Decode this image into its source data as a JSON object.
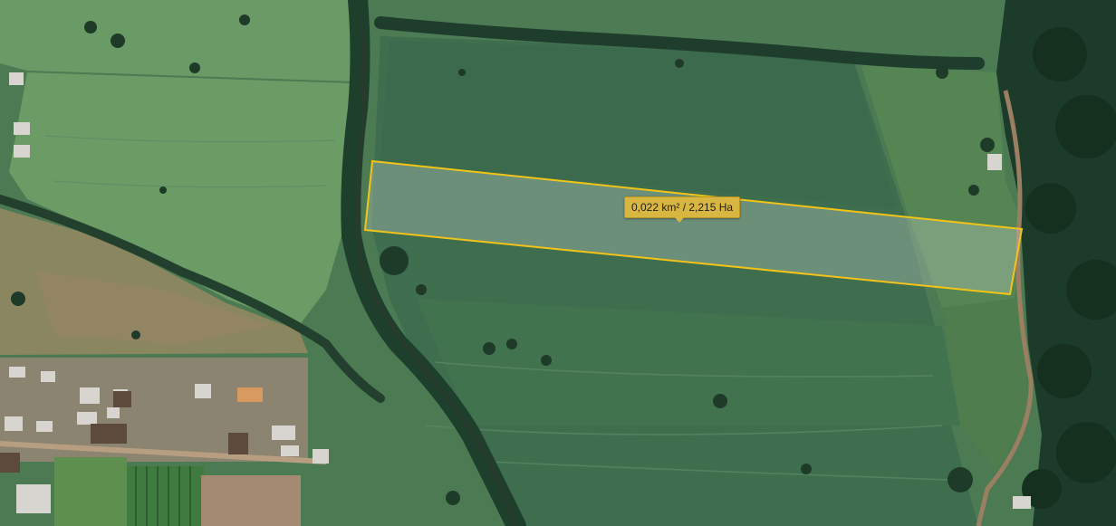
{
  "measurement": {
    "area_text": "0,022 km² / 2,215 Ha",
    "outline_color": "#f2c418",
    "fill_color": "#c9d6cf"
  },
  "map": {
    "type": "satellite",
    "features": [
      "pasture-fields",
      "tree-line",
      "forest",
      "houses",
      "dirt-road",
      "stream"
    ]
  },
  "colors": {
    "field_dark": "#3a6a4a",
    "field_light": "#5f8d5c",
    "forest": "#1c3a2a",
    "dirt": "#a8826a"
  }
}
